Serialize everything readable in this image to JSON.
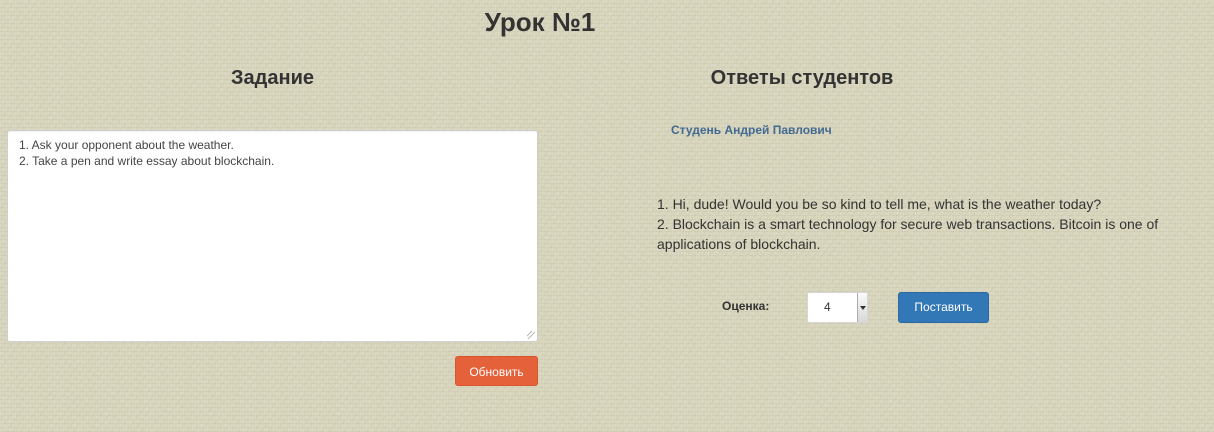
{
  "page": {
    "title": "Урок №1"
  },
  "task": {
    "heading": "Задание",
    "lines": [
      "1. Ask your opponent about the weather.",
      "2. Take a pen and write essay about blockchain."
    ],
    "update_button_label": "Обновить"
  },
  "answers": {
    "heading": "Ответы студентов",
    "student_name": "Студень Андрей Павлович",
    "answer_lines": [
      "1. Hi, dude! Would you be so kind to tell me, what is the weather today?",
      "2. Blockchain is a smart technology for secure web transactions. Bitcoin is one of applications of blockchain."
    ],
    "grade_label": "Оценка:",
    "grade_value": "4",
    "submit_button_label": "Поставить"
  },
  "colors": {
    "background": "#d8d5bd",
    "update_button": "#e4613a",
    "submit_button": "#3278b6",
    "student_name": "#436a93"
  },
  "icons": {
    "grade_dropdown": "chevron-down-icon",
    "textarea_resize": "resize-grip-icon"
  }
}
